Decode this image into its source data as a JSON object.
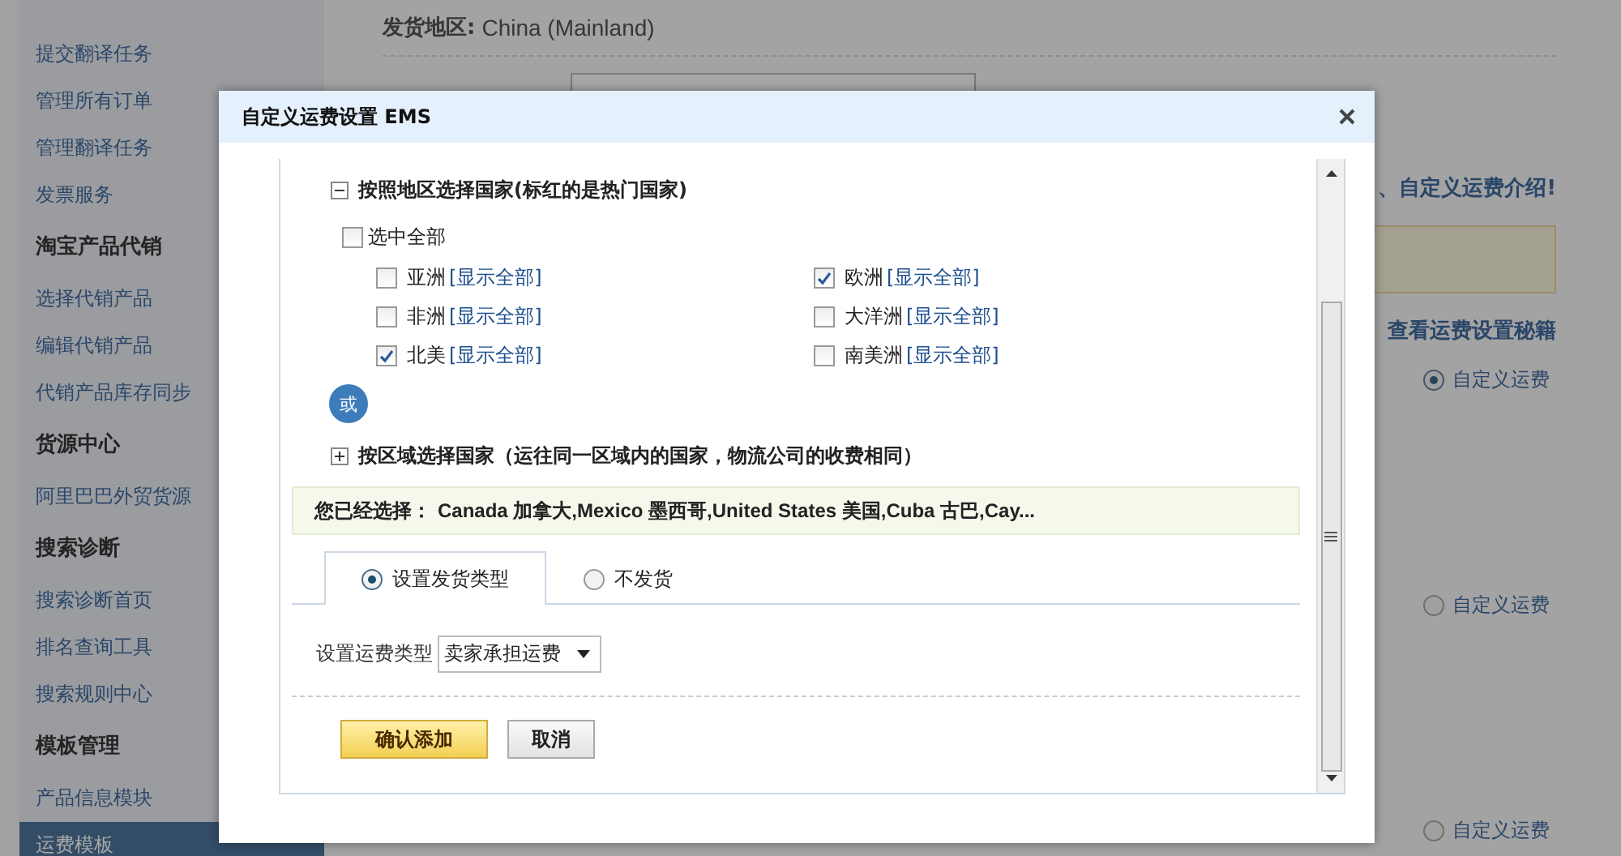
{
  "sidebar": {
    "groups": [
      {
        "items": [
          {
            "label": "提交翻译任务",
            "selected": false
          },
          {
            "label": "管理所有订单",
            "selected": false
          },
          {
            "label": "管理翻译任务",
            "selected": false
          },
          {
            "label": "发票服务",
            "selected": false
          }
        ]
      },
      {
        "heading": "淘宝产品代销",
        "items": [
          {
            "label": "选择代销产品",
            "selected": false
          },
          {
            "label": "编辑代销产品",
            "selected": false
          },
          {
            "label": "代销产品库存同步",
            "selected": false
          }
        ]
      },
      {
        "heading": "货源中心",
        "items": [
          {
            "label": "阿里巴巴外贸货源",
            "selected": false
          }
        ]
      },
      {
        "heading": "搜索诊断",
        "items": [
          {
            "label": "搜索诊断首页",
            "selected": false
          },
          {
            "label": "排名查询工具",
            "selected": false
          },
          {
            "label": "搜索规则中心",
            "selected": false
          }
        ]
      },
      {
        "heading": "模板管理",
        "items": [
          {
            "label": "产品信息模块",
            "selected": false
          },
          {
            "label": "运费模板",
            "selected": true
          }
        ]
      }
    ]
  },
  "form": {
    "ship_from_label": "发货地区:",
    "ship_from_value": "China (Mainland)",
    "intro_link": "、自定义运费介绍!",
    "tips_link": "查看运费设置秘籍",
    "options": [
      {
        "label": "自定义运费",
        "selected": true
      },
      {
        "label": "自定义运费",
        "selected": false
      },
      {
        "label": "自定义运费",
        "selected": false
      }
    ]
  },
  "dialog": {
    "title": "自定义运费设置 EMS",
    "by_region": {
      "label": "按照地区选择国家(标红的是热门国家)",
      "expanded": true
    },
    "select_all": {
      "label": "选中全部",
      "checked": false
    },
    "regions": [
      {
        "label": "亚洲",
        "link": "[显示全部]",
        "checked": false
      },
      {
        "label": "欧洲",
        "link": "[显示全部]",
        "checked": true
      },
      {
        "label": "非洲",
        "link": "[显示全部]",
        "checked": false
      },
      {
        "label": "大洋洲",
        "link": "[显示全部]",
        "checked": false
      },
      {
        "label": "北美",
        "link": "[显示全部]",
        "checked": true
      },
      {
        "label": "南美洲",
        "link": "[显示全部]",
        "checked": false
      }
    ],
    "or_badge": "或",
    "by_zone": {
      "label": "按区域选择国家（运往同一区域内的国家，物流公司的收费相同）",
      "expanded": false
    },
    "selection": {
      "label": "您已经选择：",
      "value": "Canada 加拿大,Mexico 墨西哥,United States 美国,Cuba 古巴,Cay..."
    },
    "tabs": [
      {
        "label": "设置发货类型",
        "selected": true
      },
      {
        "label": "不发货",
        "selected": false
      }
    ],
    "shipping_type": {
      "label": "设置运费类型",
      "value": "卖家承担运费"
    },
    "buttons": [
      {
        "label": "确认添加",
        "kind": "primary"
      },
      {
        "label": "取消",
        "kind": "secondary"
      }
    ]
  }
}
